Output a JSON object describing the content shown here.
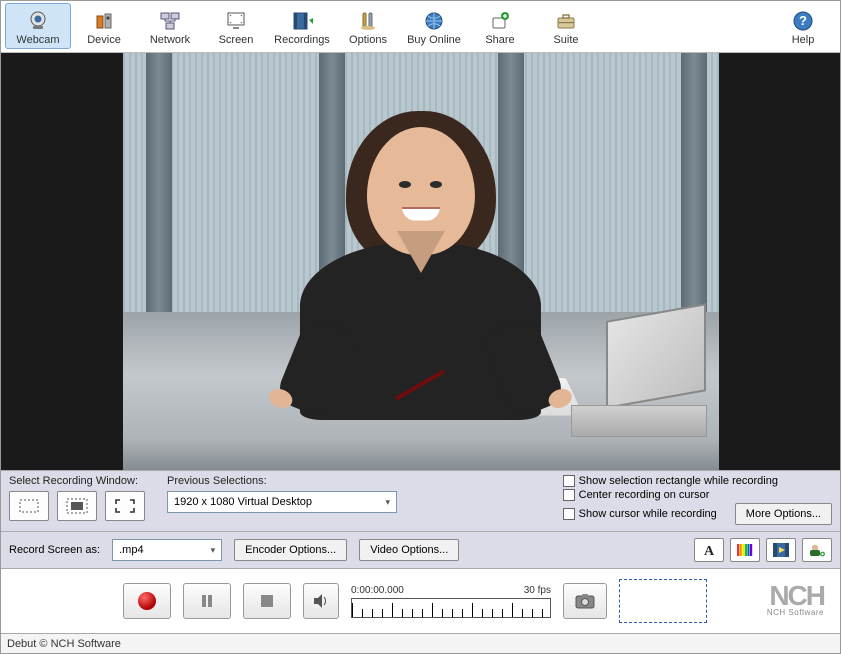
{
  "toolbar": {
    "items": [
      {
        "label": "Webcam",
        "icon": "webcam-icon",
        "active": true
      },
      {
        "label": "Device",
        "icon": "device-icon",
        "active": false
      },
      {
        "label": "Network",
        "icon": "network-icon",
        "active": false
      },
      {
        "label": "Screen",
        "icon": "screen-icon",
        "active": false
      },
      {
        "label": "Recordings",
        "icon": "recordings-icon",
        "active": false
      },
      {
        "label": "Options",
        "icon": "options-icon",
        "active": false
      },
      {
        "label": "Buy Online",
        "icon": "globe-icon",
        "active": false
      },
      {
        "label": "Share",
        "icon": "share-icon",
        "active": false
      },
      {
        "label": "Suite",
        "icon": "suite-icon",
        "active": false
      }
    ],
    "help_label": "Help"
  },
  "midstrip": {
    "select_window_label": "Select Recording Window:",
    "previous_label": "Previous Selections:",
    "previous_value": "1920 x 1080 Virtual Desktop",
    "chk1": "Show selection rectangle while recording",
    "chk2": "Center recording on cursor",
    "chk3": "Show cursor while recording",
    "more_options": "More Options..."
  },
  "recordrow": {
    "label": "Record Screen as:",
    "format": ".mp4",
    "encoder": "Encoder Options...",
    "video": "Video Options..."
  },
  "transport": {
    "time": "0:00:00.000",
    "fps": "30 fps"
  },
  "branding": {
    "logo": "NCH",
    "logo_sub": "NCH Software"
  },
  "status": {
    "text": "Debut © NCH Software"
  },
  "colors": {
    "accent": "#cfe5f7",
    "panel": "#dcdce8"
  }
}
